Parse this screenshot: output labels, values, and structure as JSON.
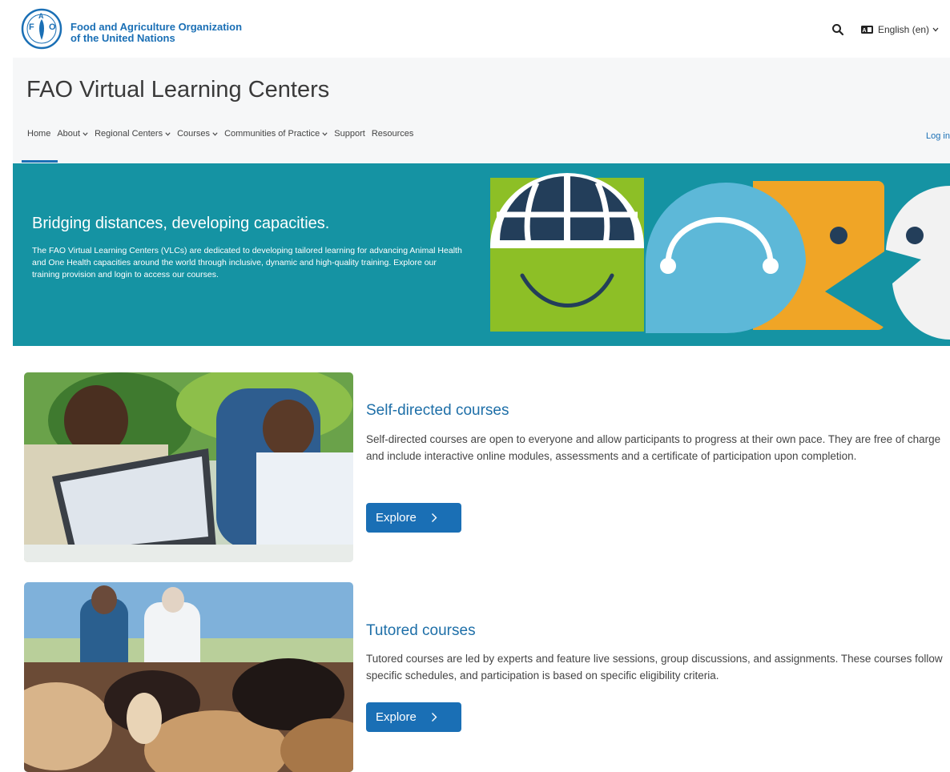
{
  "org": {
    "name_line1": "Food and Agriculture Organization",
    "name_line2": "of the United Nations"
  },
  "language": {
    "label": "English (en)"
  },
  "site": {
    "title": "FAO Virtual Learning Centers"
  },
  "nav": {
    "items": [
      {
        "label": "Home"
      },
      {
        "label": "About"
      },
      {
        "label": "Regional Centers"
      },
      {
        "label": "Courses"
      },
      {
        "label": "Communities of Practice"
      },
      {
        "label": "Support"
      },
      {
        "label": "Resources"
      }
    ],
    "login": "Log in"
  },
  "hero": {
    "heading": "Bridging distances, developing capacities.",
    "text": "The FAO Virtual Learning Centers (VLCs) are dedicated to developing tailored learning for advancing Animal Health and One Health capacities around the world through inclusive, dynamic and high-quality training. Explore our training provision and login to access our courses."
  },
  "cards": [
    {
      "title": "Self-directed courses",
      "description": "Self-directed courses are open to everyone and allow participants to progress at their own pace. They are free of charge and include interactive online modules, assessments and a certificate of participation upon completion.",
      "button": "Explore"
    },
    {
      "title": "Tutored courses",
      "description": "Tutored courses are led by experts and feature live sessions, group discussions, and assignments. These courses follow specific schedules, and participation is based on specific eligibility criteria.",
      "button": "Explore"
    }
  ],
  "colors": {
    "brand_blue": "#1a6fb5",
    "hero_teal": "#1593a3",
    "green": "#8dbf26",
    "light_blue": "#5db8d8",
    "orange": "#f0a526",
    "navy": "#233e5a"
  },
  "icons": {
    "search": "search-icon",
    "language": "language-icon",
    "chevron": "chevron-down-icon",
    "arrow": "chevron-right-icon"
  }
}
